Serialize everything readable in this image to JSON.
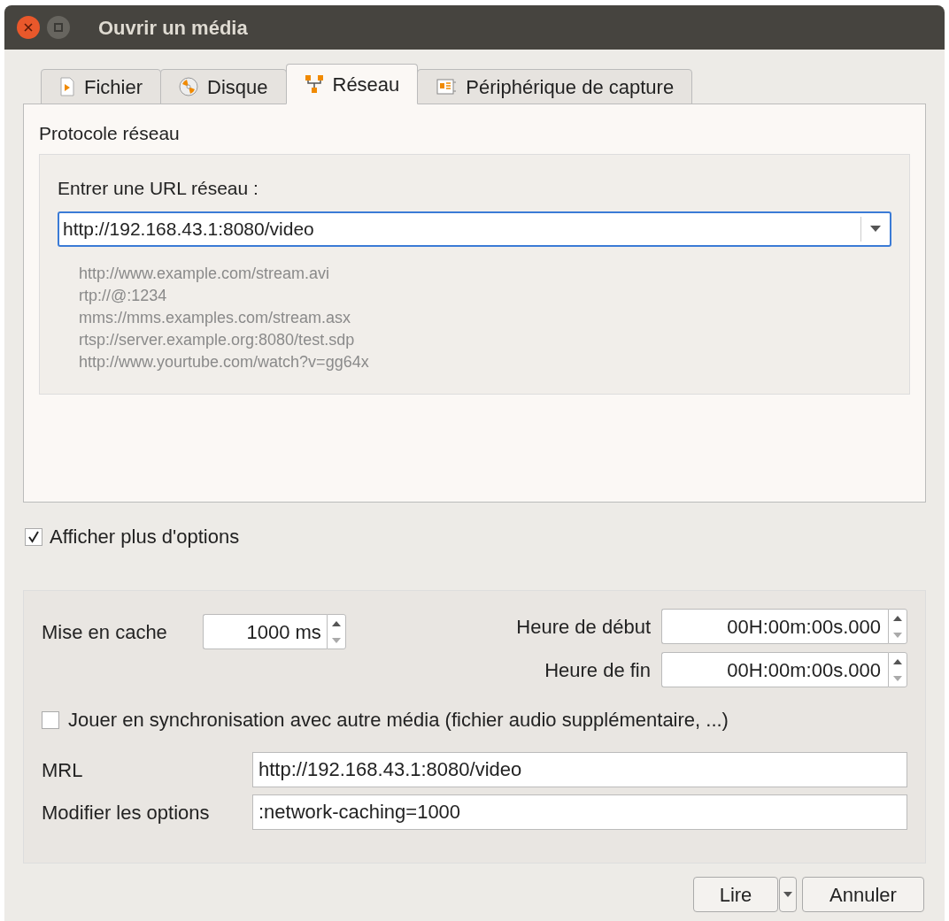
{
  "window": {
    "title": "Ouvrir un média"
  },
  "tabs": [
    {
      "label": "Fichier",
      "kind": "file",
      "selected": false
    },
    {
      "label": "Disque",
      "kind": "disc",
      "selected": false
    },
    {
      "label": "Réseau",
      "kind": "network",
      "selected": true
    },
    {
      "label": "Périphérique de capture",
      "kind": "capture",
      "selected": false
    }
  ],
  "network": {
    "heading": "Protocole réseau",
    "url_label": "Entrer une URL réseau :",
    "url_value": "http://192.168.43.1:8080/video",
    "examples": [
      "http://www.example.com/stream.avi",
      "rtp://@:1234",
      "mms://mms.examples.com/stream.asx",
      "rtsp://server.example.org:8080/test.sdp",
      "http://www.yourtube.com/watch?v=gg64x"
    ]
  },
  "more_options": {
    "label": "Afficher plus d'options",
    "checked": true
  },
  "options": {
    "cache_label": "Mise en cache",
    "cache_value": "1000 ms",
    "start_label": "Heure de début",
    "start_value": "00H:00m:00s.000",
    "end_label": "Heure de fin",
    "end_value": "00H:00m:00s.000",
    "sync": {
      "label": "Jouer en synchronisation avec autre média (fichier audio supplémentaire, ...)",
      "checked": false
    },
    "mrl_label": "MRL",
    "mrl_value": "http://192.168.43.1:8080/video",
    "edit_label": "Modifier les options",
    "edit_value": ":network-caching=1000"
  },
  "buttons": {
    "play": "Lire",
    "cancel": "Annuler"
  }
}
